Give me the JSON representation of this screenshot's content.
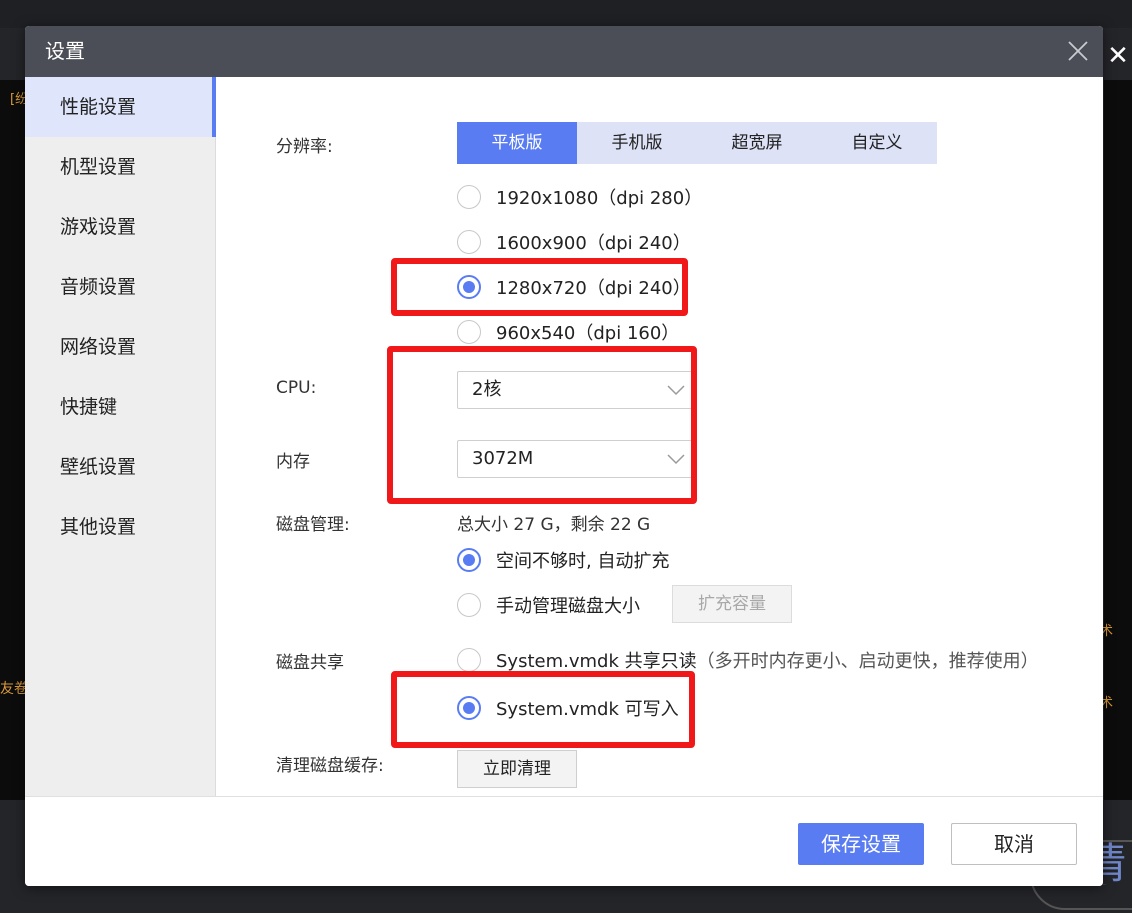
{
  "background": {
    "fragments": [
      "[纷",
      "友卷",
      "术",
      "术"
    ],
    "close_glyph": "✕",
    "bottom_text": "情"
  },
  "dialog": {
    "title": "设置"
  },
  "sidebar": {
    "items": [
      {
        "label": "性能设置",
        "active": true
      },
      {
        "label": "机型设置",
        "active": false
      },
      {
        "label": "游戏设置",
        "active": false
      },
      {
        "label": "音频设置",
        "active": false
      },
      {
        "label": "网络设置",
        "active": false
      },
      {
        "label": "快捷键",
        "active": false
      },
      {
        "label": "壁纸设置",
        "active": false
      },
      {
        "label": "其他设置",
        "active": false
      }
    ]
  },
  "resolution": {
    "label": "分辨率:",
    "tabs": [
      "平板版",
      "手机版",
      "超宽屏",
      "自定义"
    ],
    "active_tab": "平板版",
    "options": [
      {
        "label": "1920x1080（dpi 280）",
        "checked": false
      },
      {
        "label": "1600x900（dpi 240）",
        "checked": false
      },
      {
        "label": "1280x720（dpi 240）",
        "checked": true
      },
      {
        "label": "960x540（dpi 160）",
        "checked": false
      }
    ]
  },
  "cpu": {
    "label": "CPU:",
    "value": "2核"
  },
  "memory": {
    "label": "内存",
    "value": "3072M"
  },
  "disk": {
    "label": "磁盘管理:",
    "summary": "总大小 27 G，剩余 22 G",
    "options": [
      {
        "label": "空间不够时, 自动扩充",
        "checked": true
      },
      {
        "label": "手动管理磁盘大小",
        "checked": false
      }
    ],
    "expand_button": "扩充容量"
  },
  "disk_share": {
    "label": "磁盘共享",
    "options": [
      {
        "label": "System.vmdk 共享只读",
        "hint": "（多开时内存更小、启动更快，推荐使用）",
        "checked": false
      },
      {
        "label": "System.vmdk 可写入",
        "hint": "",
        "checked": true
      }
    ]
  },
  "cache": {
    "label": "清理磁盘缓存:",
    "button": "立即清理"
  },
  "footer": {
    "save": "保存设置",
    "cancel": "取消"
  },
  "colors": {
    "accent": "#5a7cf2",
    "titlebar": "#4b4e57",
    "annotation": "#f01818"
  },
  "icons": [
    "close-icon",
    "chevron-down-icon"
  ]
}
